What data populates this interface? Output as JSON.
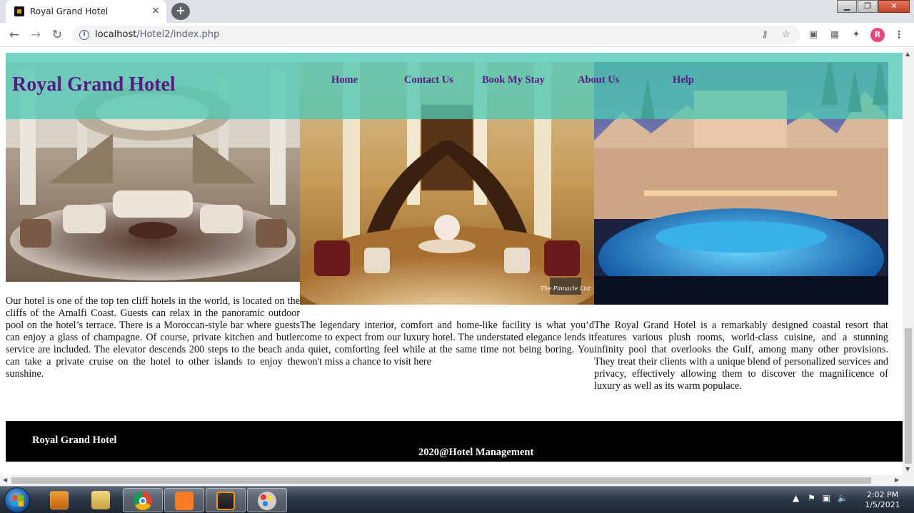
{
  "browser": {
    "tab_title": "Royal Grand Hotel",
    "tab_close": "×",
    "new_tab": "+",
    "url_host": "localhost",
    "url_path": "/Hotel2/index.php",
    "profile_initial": "R",
    "window_controls": {
      "minimize": "▁",
      "maximize": "❐",
      "close": "✕"
    }
  },
  "page": {
    "site_title": "Royal Grand Hotel",
    "nav": [
      "Home",
      "Contact Us",
      "Book My Stay",
      "About Us",
      "Help"
    ],
    "columns": [
      {
        "image": "hotel-lounge-lobby",
        "text": "Our hotel is one of the top ten cliff hotels in the world, is located on the cliffs of the Amalfi Coast. Guests can relax in the panoramic outdoor pool on the hotel’s terrace. There is a Moroccan-style bar where guests can enjoy a glass of champagne. Of course, private kitchen and butler service are included. The elevator descends 200 steps to the beach and can take a private cruise on the hotel to other islands to enjoy the sunshine."
      },
      {
        "image": "grand-staircase-interior",
        "watermark": "The Pinnacle List",
        "text": "The legendary interior, comfort and home-like facility is what you’d come to expect from our luxury hotel. The understated elegance lends it a quiet, comforting feel while at the same time not being boring. You won't miss a chance to visit here"
      },
      {
        "image": "coastal-resort-pool-night",
        "text": "The Royal Grand Hotel is a remarkably designed coastal resort that features various plush rooms, world-class cuisine, and a stunning infinity pool that overlooks the Gulf, among many other provisions. They treat their clients with a unique blend of personalized services and privacy, effectively allowing them to discover the magnificence of luxury as well as its warm populace."
      }
    ],
    "footer_title": "Royal Grand Hotel",
    "footer_copy": "2020@Hotel Management"
  },
  "colors": {
    "nav_band": "#50c8b4",
    "brand_purple": "#5a1a86",
    "footer_bg": "#000000"
  },
  "taskbar": {
    "apps": [
      "windows-media-player",
      "file-explorer",
      "google-chrome",
      "xampp-control-panel",
      "sublime-text",
      "paint"
    ],
    "active_app": "google-chrome",
    "clock_time": "2:02 PM",
    "clock_date": "1/5/2021"
  }
}
